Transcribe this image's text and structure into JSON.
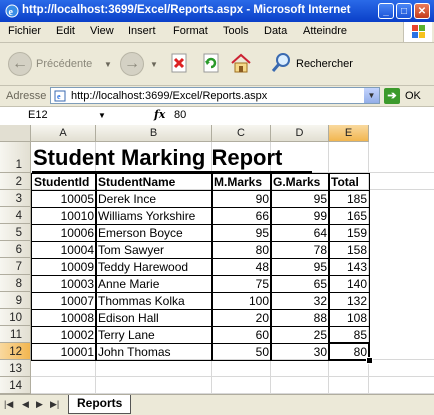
{
  "window": {
    "title": "http://localhost:3699/Excel/Reports.aspx - Microsoft Internet",
    "minimize": "_",
    "maximize": "□",
    "close": "✕"
  },
  "menu": [
    "Fichier",
    "Edit",
    "View",
    "Insert",
    "Format",
    "Tools",
    "Data",
    "Atteindre"
  ],
  "toolbar": {
    "back_label": "Précédente",
    "search_label": "Rechercher"
  },
  "address": {
    "label": "Adresse",
    "url": "http://localhost:3699/Excel/Reports.aspx",
    "go_label": "OK"
  },
  "formula_bar": {
    "cell_ref": "E12",
    "fx": "fx",
    "value": "80"
  },
  "columns": [
    "A",
    "B",
    "C",
    "D",
    "E"
  ],
  "row_numbers": [
    "1",
    "2",
    "3",
    "4",
    "5",
    "6",
    "7",
    "8",
    "9",
    "10",
    "11",
    "12",
    "13",
    "14"
  ],
  "spreadsheet": {
    "title": "Student Marking Report",
    "headers": [
      "StudentId",
      "StudentName",
      "M.Marks",
      "G.Marks",
      "Total"
    ],
    "rows": [
      [
        "10005",
        "Derek Ince",
        "90",
        "95",
        "185"
      ],
      [
        "10010",
        "Williams Yorkshire",
        "66",
        "99",
        "165"
      ],
      [
        "10006",
        "Emerson Boyce",
        "95",
        "64",
        "159"
      ],
      [
        "10004",
        "Tom Sawyer",
        "80",
        "78",
        "158"
      ],
      [
        "10009",
        "Teddy Harewood",
        "48",
        "95",
        "143"
      ],
      [
        "10003",
        "Anne Marie",
        "75",
        "65",
        "140"
      ],
      [
        "10007",
        "Thommas Kolka",
        "100",
        "32",
        "132"
      ],
      [
        "10008",
        "Edison Hall",
        "20",
        "88",
        "108"
      ],
      [
        "10002",
        "Terry Lane",
        "60",
        "25",
        "85"
      ],
      [
        "10001",
        "John Thomas",
        "50",
        "30",
        "80"
      ]
    ]
  },
  "selected": {
    "column": "E",
    "row": "12"
  },
  "sheet_tabs": [
    "Reports"
  ],
  "colors": {
    "titlebar": "#0a3fc8",
    "chrome": "#ece9d8",
    "selected_header": "#f2b650"
  }
}
